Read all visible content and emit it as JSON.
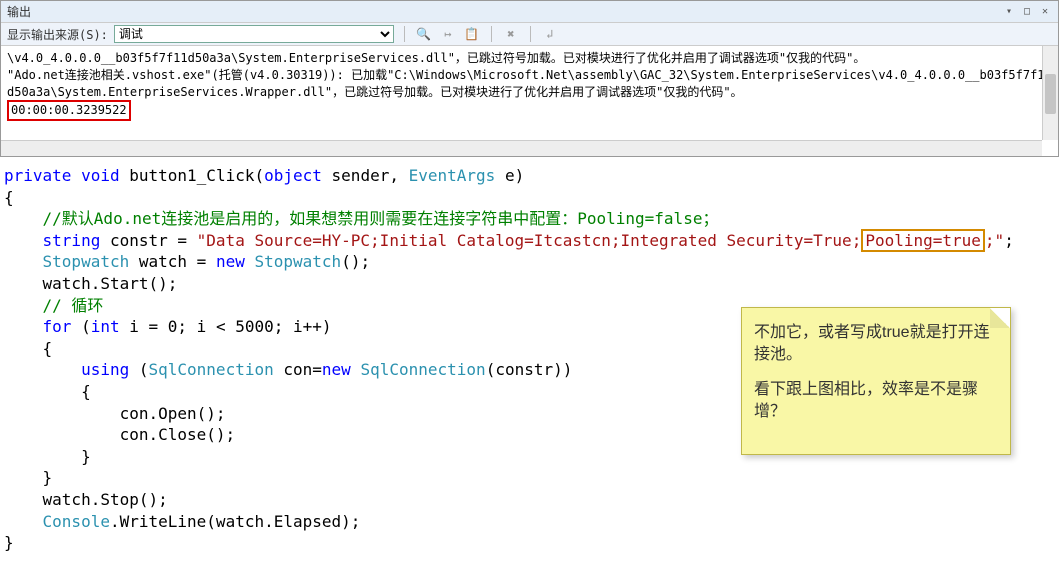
{
  "output": {
    "title": "输出",
    "sourceLabel": "显示输出来源(S):",
    "sourceSelected": "调试",
    "lines": [
      "\\v4.0_4.0.0.0__b03f5f7f11d50a3a\\System.EnterpriseServices.dll\"，已跳过符号加载。已对模块进行了优化并启用了调试器选项\"仅我的代码\"。",
      "\"Ado.net连接池相关.vshost.exe\"(托管(v4.0.30319)): 已加载\"C:\\Windows\\Microsoft.Net\\assembly\\GAC_32\\System.EnterpriseServices\\v4.0_4.0.0.0__b03f5f7f11d50a3a\\System.EnterpriseServices.Wrapper.dll\"，已跳过符号加载。已对模块进行了优化并启用了调试器选项\"仅我的代码\"。"
    ],
    "elapsed": "00:00:00.3239522"
  },
  "code": {
    "sig_private": "private",
    "sig_void": "void",
    "sig_name": " button1_Click(",
    "sig_object": "object",
    "sig_sender": " sender, ",
    "sig_eventargs": "EventArgs",
    "sig_e": " e)",
    "brace_open": "{",
    "comment1": "//默认Ado.net连接池是启用的，如果想禁用则需要在连接字符串中配置：Pooling=false；",
    "string_kw": "string",
    "constr_decl": " constr = ",
    "constr_val_pre": "\"Data Source=HY-PC;Initial Catalog=Itcastcn;Integrated Security=True;",
    "constr_pooling": "Pooling=true",
    "constr_val_post": ";\"",
    "semicolon": ";",
    "stopwatch_type": "Stopwatch",
    "watch_decl": " watch = ",
    "new_kw": "new",
    "stopwatch_ctor": "Stopwatch",
    "unit_paren": "();",
    "watch_start": "    watch.Start();",
    "comment2": "// 循环",
    "for_kw": "for",
    "for_open": " (",
    "int_kw": "int",
    "for_cond": " i = 0; i < 5000; i++)",
    "inner_brace_open": "    {",
    "using_kw": "using",
    "using_open": " (",
    "sqlconn_type": "SqlConnection",
    "con_decl": " con=",
    "sqlconn_ctor": "SqlConnection",
    "con_arg": "(constr))",
    "inner2_brace_open": "        {",
    "con_open": "            con.Open();",
    "con_close": "            con.Close();",
    "inner2_brace_close": "        }",
    "inner_brace_close": "    }",
    "watch_stop": "    watch.Stop();",
    "console_type": "Console",
    "writeline": ".WriteLine(watch.Elapsed);",
    "brace_close": "}"
  },
  "note": {
    "p1": "不加它，或者写成true就是打开连接池。",
    "p2": "看下跟上图相比，效率是不是骤增？"
  }
}
